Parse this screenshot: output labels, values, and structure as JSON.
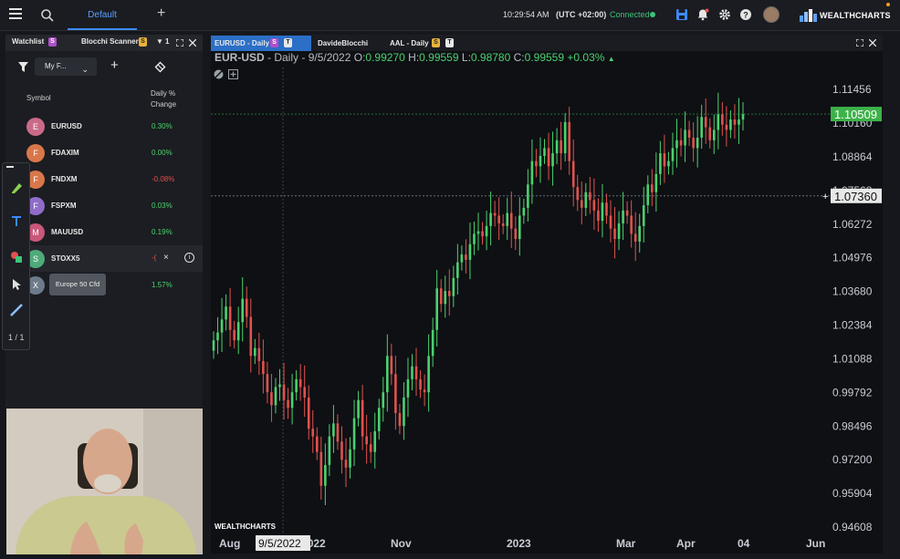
{
  "topbar": {
    "tab_label": "Default",
    "time": "10:29:54 AM",
    "timezone": "(UTC +02:00)",
    "connection_status": "Connected",
    "logo_text": "WEALTHCHARTS"
  },
  "left_panel": {
    "tabs": [
      {
        "label": "Watchlist",
        "badge": "S"
      },
      {
        "label": "Blocchi Scanner",
        "badge": "S"
      }
    ],
    "tab_counter": "1",
    "list_select": "My F...",
    "column_symbol": "Symbol",
    "column_change_line1": "Daily %",
    "column_change_line2": "Change",
    "rows": [
      {
        "initial": "E",
        "symbol": "EURUSD",
        "change": "0.30%",
        "color": "#c96a88",
        "dir": "up"
      },
      {
        "initial": "F",
        "symbol": "FDAXIM",
        "change": "0.00%",
        "color": "#d9774a",
        "dir": "up"
      },
      {
        "initial": "F",
        "symbol": "FNDXM",
        "change": "-0.08%",
        "color": "#d9774a",
        "dir": "down"
      },
      {
        "initial": "F",
        "symbol": "FSPXM",
        "change": "0.03%",
        "color": "#8f6cc9",
        "dir": "up"
      },
      {
        "initial": "M",
        "symbol": "MAUUSD",
        "change": "0.19%",
        "color": "#c9577a",
        "dir": "up"
      },
      {
        "initial": "S",
        "symbol": "STOXX5",
        "change": "",
        "color": "#4faa7a",
        "dir": "down"
      },
      {
        "initial": "X",
        "symbol": "",
        "change": "1.57%",
        "color": "#6c7a8a",
        "dir": "up"
      }
    ],
    "tooltip": "Europe 50 Cfd",
    "row_remove_glyph": "-(",
    "draw_page": "1 / 1"
  },
  "chart_tabs": [
    {
      "label": "EURUSD - Daily",
      "badges": [
        "S",
        "T"
      ]
    },
    {
      "label": "DavideBlocchi",
      "badges": []
    },
    {
      "label": "AAL - Daily",
      "badges": [
        "S",
        "T"
      ]
    }
  ],
  "chart_header": {
    "symbol": "EUR-USD",
    "interval": "Daily",
    "date": "9/5/2022",
    "o_label": "O:",
    "open": "0.99270",
    "h_label": "H:",
    "high": "0.99559",
    "l_label": "L:",
    "low": "0.98780",
    "c_label": "C:",
    "close": "0.99559",
    "change": "+0.03%"
  },
  "chart_watermark": "WEALTHCHARTS",
  "colors": {
    "up": "#4cd16e",
    "down": "#e0524e",
    "accent": "#3d8bff",
    "last_price": "#3db24a"
  },
  "chart_data": {
    "type": "candlestick",
    "y_ticks": [
      "1.11456",
      "1.10160",
      "1.08864",
      "1.07568",
      "1.06272",
      "1.04976",
      "1.03680",
      "1.02384",
      "1.01088",
      "0.99792",
      "0.98496",
      "0.97200",
      "0.95904",
      "0.94608"
    ],
    "ylim": [
      0.9461,
      1.1146
    ],
    "x_ticks": [
      "Aug",
      "9/5/2022",
      "Nov",
      "2023",
      "Mar",
      "Apr",
      "04",
      "Jun"
    ],
    "last_price": "1.10509",
    "crosshair_price": "1.07360",
    "crosshair_date": "9/5/2022",
    "series": [
      {
        "name": "EUR-USD",
        "values": [
          1.018,
          1.021,
          1.026,
          1.031,
          1.022,
          1.018,
          1.025,
          1.034,
          1.027,
          1.012,
          1.015,
          1.01,
          1.005,
          0.998,
          0.993,
          1.0,
          1.001,
          0.995,
          0.992,
          0.998,
          1.003,
          1.0,
          0.996,
          0.984,
          0.981,
          0.975,
          0.962,
          0.97,
          0.981,
          0.986,
          0.979,
          0.972,
          0.969,
          0.976,
          0.988,
          0.995,
          0.981,
          0.978,
          0.975,
          0.983,
          0.992,
          0.998,
          1.012,
          1.005,
          0.99,
          0.985,
          0.996,
          1.003,
          1.008,
          1.003,
          0.999,
          0.998,
          1.012,
          1.022,
          1.038,
          1.032,
          1.037,
          1.035,
          1.042,
          1.048,
          1.051,
          1.049,
          1.055,
          1.059,
          1.06,
          1.058,
          1.062,
          1.067,
          1.066,
          1.063,
          1.062,
          1.067,
          1.061,
          1.057,
          1.066,
          1.069,
          1.078,
          1.087,
          1.085,
          1.089,
          1.092,
          1.085,
          1.09,
          1.095,
          1.09,
          1.102,
          1.087,
          1.077,
          1.072,
          1.069,
          1.075,
          1.072,
          1.068,
          1.064,
          1.071,
          1.066,
          1.061,
          1.057,
          1.063,
          1.068,
          1.066,
          1.059,
          1.056,
          1.062,
          1.07,
          1.078,
          1.075,
          1.082,
          1.09,
          1.085,
          1.087,
          1.092,
          1.095,
          1.093,
          1.099,
          1.096,
          1.092,
          1.096,
          1.104,
          1.1,
          1.095,
          1.099,
          1.105,
          1.101,
          1.099,
          1.103,
          1.101,
          1.103,
          1.105
        ]
      }
    ]
  }
}
